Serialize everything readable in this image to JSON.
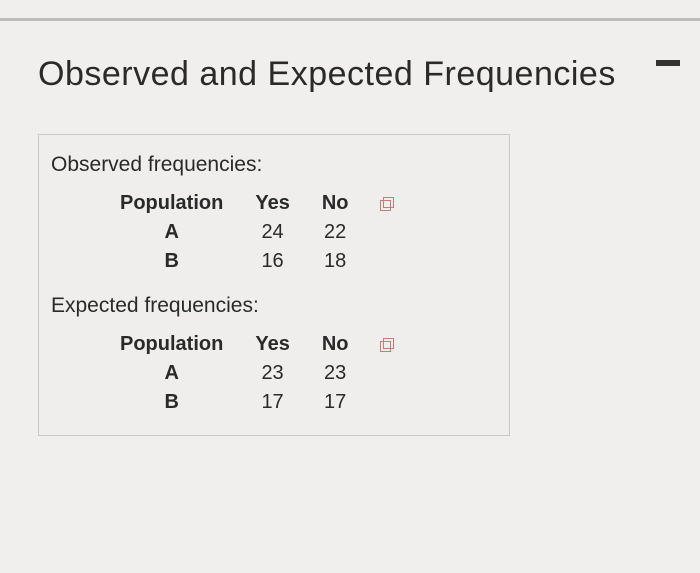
{
  "title": "Observed and Expected Frequencies",
  "observed": {
    "label": "Observed frequencies:",
    "headers": {
      "col1": "Population",
      "col2": "Yes",
      "col3": "No"
    },
    "rows": [
      {
        "label": "A",
        "yes": "24",
        "no": "22"
      },
      {
        "label": "B",
        "yes": "16",
        "no": "18"
      }
    ]
  },
  "expected": {
    "label": "Expected frequencies:",
    "headers": {
      "col1": "Population",
      "col2": "Yes",
      "col3": "No"
    },
    "rows": [
      {
        "label": "A",
        "yes": "23",
        "no": "23"
      },
      {
        "label": "B",
        "yes": "17",
        "no": "17"
      }
    ]
  },
  "chart_data": [
    {
      "type": "table",
      "title": "Observed frequencies",
      "columns": [
        "Population",
        "Yes",
        "No"
      ],
      "rows": [
        [
          "A",
          24,
          22
        ],
        [
          "B",
          16,
          18
        ]
      ]
    },
    {
      "type": "table",
      "title": "Expected frequencies",
      "columns": [
        "Population",
        "Yes",
        "No"
      ],
      "rows": [
        [
          "A",
          23,
          23
        ],
        [
          "B",
          17,
          17
        ]
      ]
    }
  ]
}
